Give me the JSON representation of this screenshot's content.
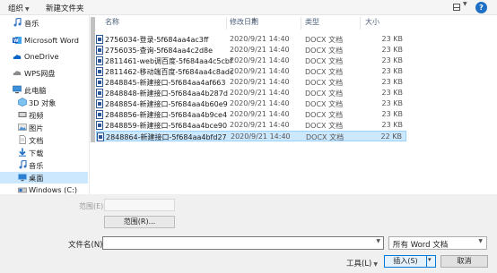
{
  "toolbar": {
    "organize_label": "组织",
    "newfolder_label": "新建文件夹"
  },
  "sidebar": {
    "items": [
      {
        "label": "音乐",
        "icon": "music-icon"
      },
      {
        "label": "Microsoft Word",
        "icon": "word-icon"
      },
      {
        "label": "OneDrive",
        "icon": "cloud-icon"
      },
      {
        "label": "WPS网盘",
        "icon": "wps-cloud-icon"
      },
      {
        "label": "此电脑",
        "icon": "computer-icon"
      },
      {
        "label": "3D 对象",
        "icon": "cube-icon"
      },
      {
        "label": "视频",
        "icon": "video-icon"
      },
      {
        "label": "图片",
        "icon": "picture-icon"
      },
      {
        "label": "文档",
        "icon": "document-icon"
      },
      {
        "label": "下载",
        "icon": "download-icon"
      },
      {
        "label": "音乐",
        "icon": "music-icon"
      },
      {
        "label": "桌面",
        "icon": "desktop-icon"
      },
      {
        "label": "Windows (C:)",
        "icon": "drive-icon"
      }
    ]
  },
  "filelist": {
    "columns": {
      "name": "名称",
      "date": "修改日期",
      "type": "类型",
      "size": "大小"
    },
    "rows": [
      {
        "name": "2756034-登录-5f684aa4ac3ff",
        "date": "2020/9/21 14:40",
        "type": "DOCX 文档",
        "size": "23 KB"
      },
      {
        "name": "2756035-查询-5f684aa4c2d8e",
        "date": "2020/9/21 14:40",
        "type": "DOCX 文档",
        "size": "23 KB"
      },
      {
        "name": "2811461-web调百度-5f684aa4c5cbf",
        "date": "2020/9/21 14:40",
        "type": "DOCX 文档",
        "size": "23 KB"
      },
      {
        "name": "2811462-移动端百度-5f684aa4c8adc",
        "date": "2020/9/21 14:40",
        "type": "DOCX 文档",
        "size": "23 KB"
      },
      {
        "name": "2848845-新建接口-5f684aa4af663",
        "date": "2020/9/21 14:40",
        "type": "DOCX 文档",
        "size": "23 KB"
      },
      {
        "name": "2848848-新建接口-5f684aa4b287d",
        "date": "2020/9/21 14:40",
        "type": "DOCX 文档",
        "size": "23 KB"
      },
      {
        "name": "2848854-新建接口-5f684aa4b60e9",
        "date": "2020/9/21 14:40",
        "type": "DOCX 文档",
        "size": "23 KB"
      },
      {
        "name": "2848856-新建接口-5f684aa4b9ce4",
        "date": "2020/9/21 14:40",
        "type": "DOCX 文档",
        "size": "23 KB"
      },
      {
        "name": "2848859-新建接口-5f684aa4bce90",
        "date": "2020/9/21 14:40",
        "type": "DOCX 文档",
        "size": "23 KB"
      },
      {
        "name": "2848864-新建接口-5f684aa4bfd27",
        "date": "2020/9/21 14:40",
        "type": "DOCX 文档",
        "size": "22 KB"
      }
    ]
  },
  "range": {
    "label": "范围(E):",
    "button_label": "范围(R)..."
  },
  "footer": {
    "filename_label": "文件名(N):",
    "filename_value": "",
    "filetype_value": "所有 Word 文档",
    "tools_label": "工具(L)",
    "insert_label": "插入(S)",
    "cancel_label": "取消"
  },
  "colors": {
    "selection": "#cce8ff",
    "accent": "#0078d7"
  }
}
